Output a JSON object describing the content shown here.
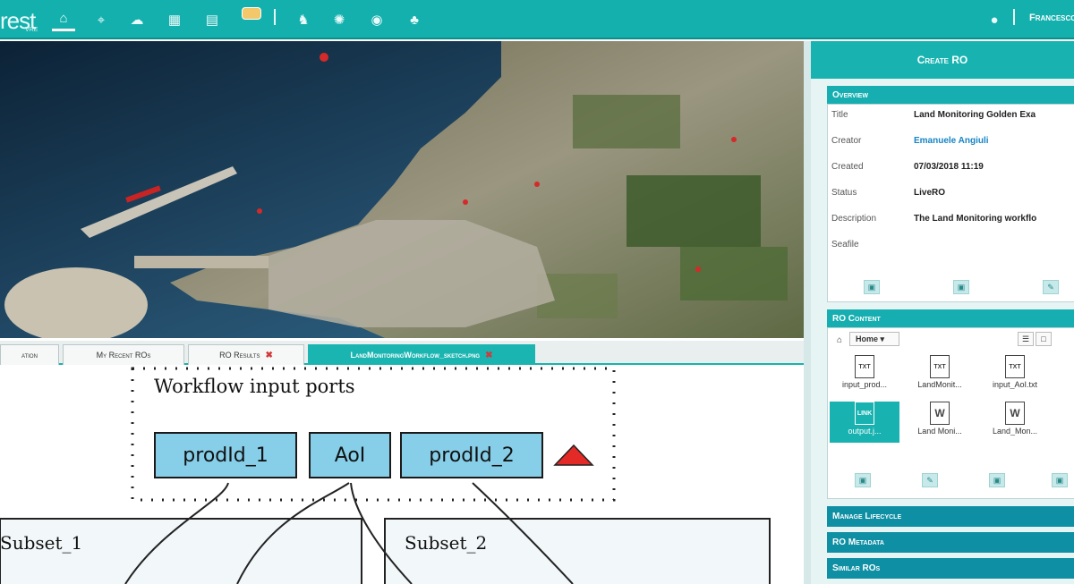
{
  "app": {
    "logo": "rest",
    "logo_sub": "VRE",
    "user": "Francesco"
  },
  "nav": {
    "icons": [
      "home-icon",
      "telescope-icon",
      "cloud-icon",
      "calculator-icon",
      "chart-icon",
      "notes-icon",
      "horse-icon",
      "gear-icon",
      "eye-icon",
      "bear-icon"
    ],
    "right_icon": "user-icon"
  },
  "tabs": [
    {
      "label": "ation",
      "active": false,
      "closable": false
    },
    {
      "label": "My Recent ROs",
      "active": false,
      "closable": false
    },
    {
      "label": "RO Results",
      "active": false,
      "closable": true
    },
    {
      "label": "LandMonitoringWorkflow_sketch.png",
      "active": true,
      "closable": true
    }
  ],
  "sketch": {
    "title": "Workflow input ports",
    "ports": [
      "prodId_1",
      "AoI",
      "prodId_2"
    ],
    "subsets": [
      "Subset_1",
      "Subset_2"
    ]
  },
  "panel": {
    "header": "Create RO",
    "overview": {
      "heading": "Overview",
      "rows": [
        {
          "key": "Title",
          "value": "Land Monitoring Golden Exa",
          "link": false
        },
        {
          "key": "Creator",
          "value": "Emanuele Angiuli",
          "link": true
        },
        {
          "key": "Created",
          "value": "07/03/2018 11:19",
          "link": false
        },
        {
          "key": "Status",
          "value": "LiveRO",
          "link": false
        },
        {
          "key": "Description",
          "value": "The Land Monitoring workflo",
          "link": false
        },
        {
          "key": "Seafile",
          "value": "",
          "link": false
        }
      ]
    },
    "content": {
      "heading": "RO Content",
      "folder": "Home",
      "files": [
        {
          "name": "input_prod...",
          "kind": "TXT",
          "selected": false
        },
        {
          "name": "LandMonit...",
          "kind": "TXT",
          "selected": false
        },
        {
          "name": "input_AoI.txt",
          "kind": "TXT",
          "selected": false
        },
        {
          "name": "output.j...",
          "kind": "LINK",
          "selected": true
        },
        {
          "name": "Land Moni...",
          "kind": "W",
          "selected": false
        },
        {
          "name": "Land_Mon...",
          "kind": "W",
          "selected": false
        }
      ]
    },
    "sections": [
      "Manage Lifecycle",
      "RO Metadata",
      "Similar ROs"
    ]
  }
}
